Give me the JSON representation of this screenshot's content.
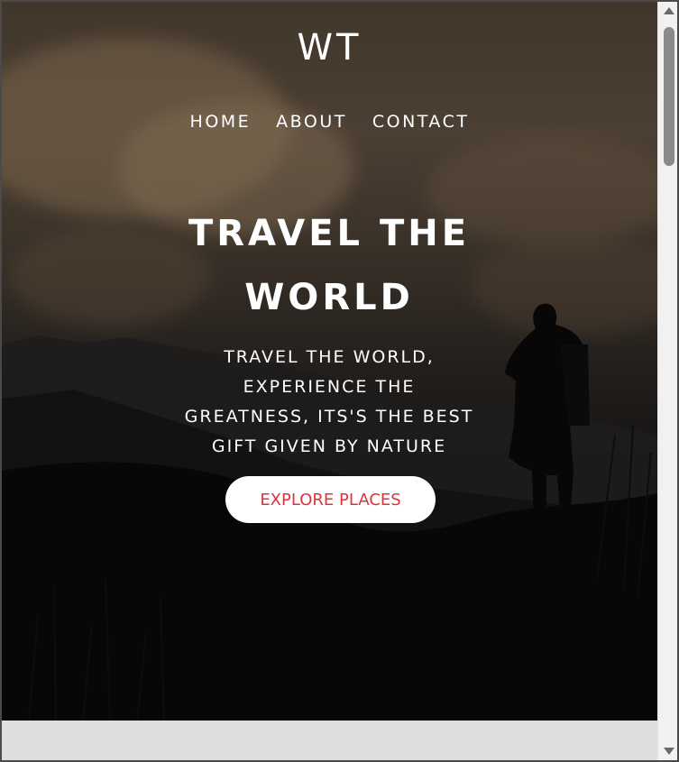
{
  "brand": {
    "logo": "WT"
  },
  "nav": {
    "items": [
      "HOME",
      "ABOUT",
      "CONTACT"
    ]
  },
  "hero": {
    "title_line1": "TRAVEL THE",
    "title_line2": "WORLD",
    "tagline": [
      "TRAVEL THE WORLD,",
      "EXPERIENCE THE",
      "GREATNESS, ITS'S THE BEST",
      "GIFT GIVEN BY NATURE"
    ],
    "cta_label": "EXPLORE PLACES"
  },
  "colors": {
    "cta_text": "#e0323e",
    "nav_text": "#ffffff",
    "cta_bg": "#ffffff"
  },
  "scrollbar": {
    "thumb_fraction": 0.18,
    "scroll_position": 0
  }
}
